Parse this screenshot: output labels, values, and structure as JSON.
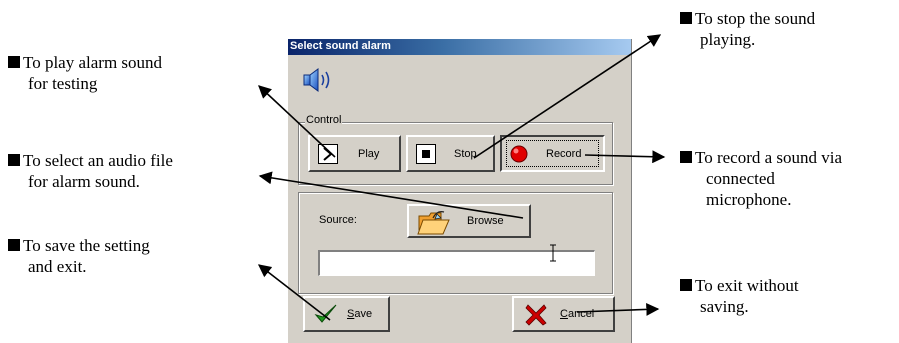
{
  "annotations": {
    "play": {
      "line1": "To play alarm sound",
      "line2": "for testing"
    },
    "select": {
      "line1": "To select an audio file",
      "line2": "for alarm sound."
    },
    "save": {
      "line1": "To save the setting",
      "line2": "and exit."
    },
    "stop": {
      "line1": "To stop the sound",
      "line2": "playing."
    },
    "record": {
      "line1": "To record a sound via",
      "line2": "connected",
      "line3": "microphone."
    },
    "cancel": {
      "line1": "To exit without",
      "line2": "saving."
    }
  },
  "dialog": {
    "title": "Select sound alarm",
    "control_group_label": "Control",
    "buttons": {
      "play": "Play",
      "stop": "Stop",
      "record": "Record",
      "browse": "Browse",
      "save": "Save",
      "cancel": "Cancel"
    },
    "source_label": "Source:",
    "source_value": ""
  },
  "colors": {
    "title_bar": "#0a246a",
    "dialog_bg": "#d4d0c8",
    "record_icon": "#e00000",
    "save_check": "#1e9a1e",
    "cancel_x": "#cc0000"
  },
  "icons": [
    "speaker-icon",
    "play-icon",
    "stop-icon",
    "record-icon",
    "folder-icon",
    "checkmark-icon",
    "x-icon",
    "text-cursor-icon"
  ]
}
